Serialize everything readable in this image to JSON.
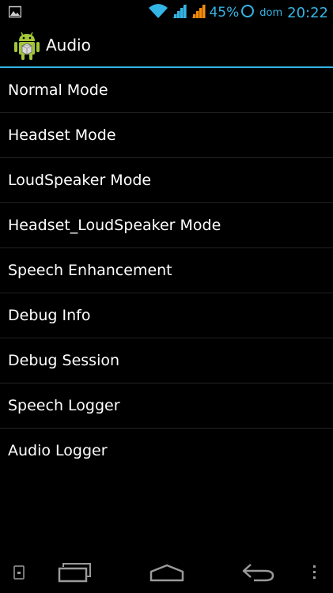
{
  "status_bar": {
    "battery": "45%",
    "carrier": "dom",
    "time": "20:22",
    "accent_color": "#33b5e5",
    "icons": [
      "image-notification-icon",
      "wifi-icon",
      "signal-icon",
      "signal-icon-2",
      "battery-icon"
    ]
  },
  "action_bar": {
    "title": "Audio",
    "icon": "android-app-icon"
  },
  "menu": {
    "items": [
      "Normal Mode",
      "Headset Mode",
      "LoudSpeaker Mode",
      "Headset_LoudSpeaker Mode",
      "Speech Enhancement",
      "Debug Info",
      "Debug Session",
      "Speech Logger",
      "Audio Logger"
    ]
  },
  "nav_bar": {
    "icons": [
      "screenshot-icon",
      "recent-apps-icon",
      "home-icon",
      "back-icon",
      "menu-icon"
    ]
  }
}
